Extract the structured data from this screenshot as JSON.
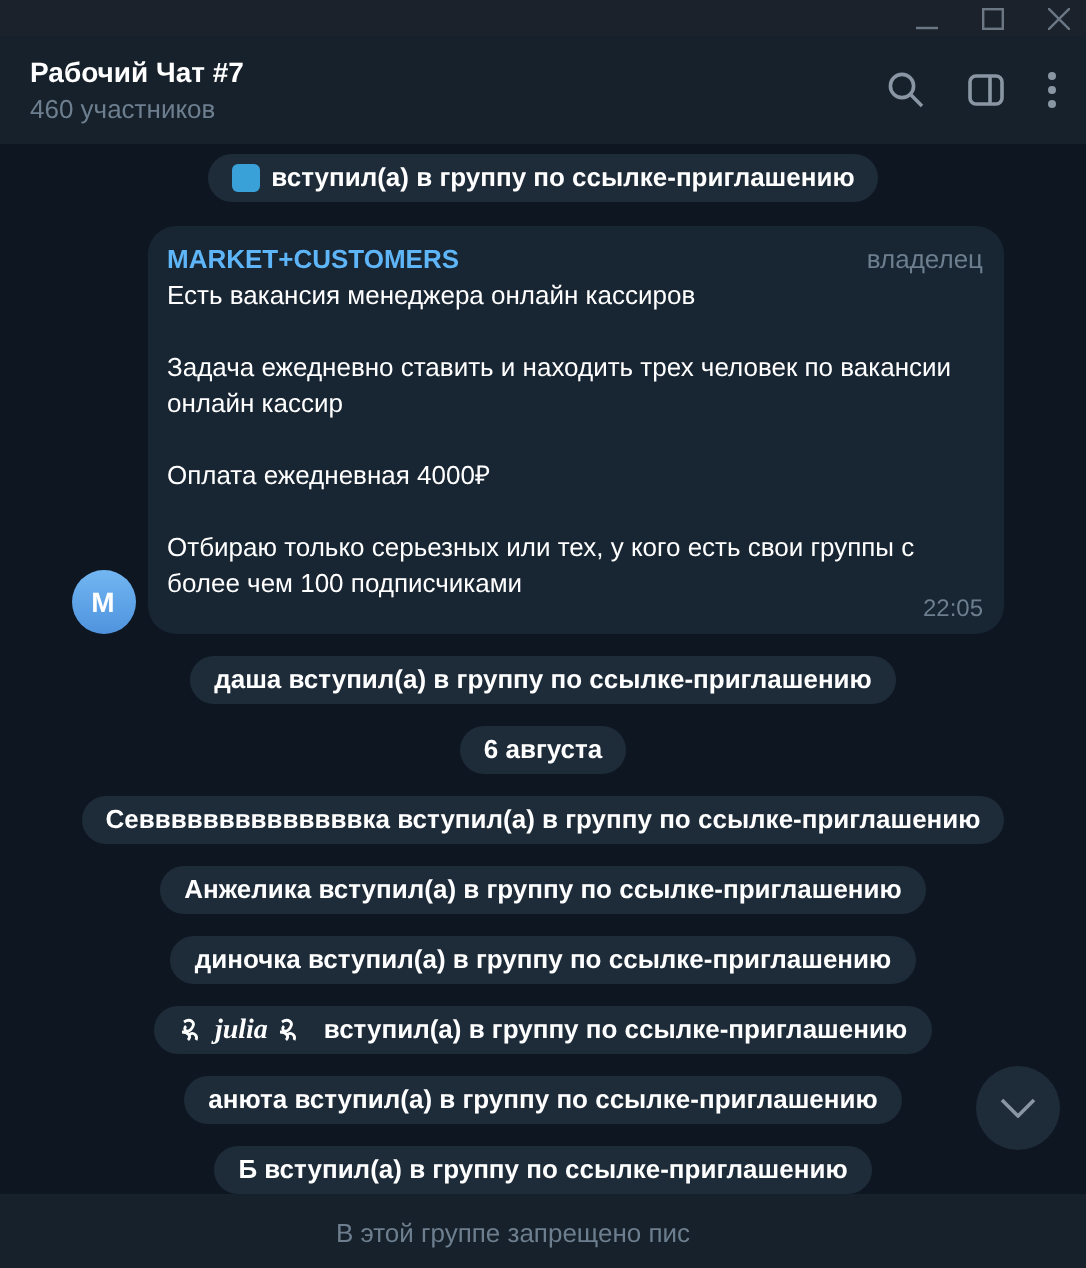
{
  "header": {
    "title": "Рабочий Чат #7",
    "subtitle": "460 участников"
  },
  "messages": [
    {
      "kind": "service_icon",
      "text": "вступил(а) в группу по ссылке-приглашению"
    },
    {
      "kind": "message",
      "avatar": "M",
      "author": "MARKET+CUSTOMERS",
      "role": "владелец",
      "paragraphs": [
        "Есть вакансия менеджера онлайн кассиров",
        "Задача ежедневно ставить и находить трех человек по вакансии онлайн кассир",
        "Оплата ежедневная 4000₽",
        "Отбираю только серьезных или тех, у кого есть свои группы с более чем 100 подписчиками"
      ],
      "time": "22:05"
    },
    {
      "kind": "service",
      "text": "даша вступил(а) в группу по ссылке-приглашению"
    },
    {
      "kind": "date",
      "text": "6 августа"
    },
    {
      "kind": "service",
      "text": "Севвввввввввввввка вступил(а) в группу по ссылке-приглашению"
    },
    {
      "kind": "service",
      "text": "Анжелика вступил(а) в группу по ссылке-приглашению"
    },
    {
      "kind": "service",
      "text": "диночка вступил(а) в группу по ссылке-приглашению"
    },
    {
      "kind": "service_fancy",
      "name": "julia",
      "text": "вступил(а) в группу по ссылке-приглашению"
    },
    {
      "kind": "service",
      "text": "анюта вступил(а) в группу по ссылке-приглашению"
    },
    {
      "kind": "service",
      "text": "Б вступил(а) в группу по ссылке-приглашению"
    }
  ],
  "footer": {
    "notice": "В этой группе запрещено пис"
  }
}
